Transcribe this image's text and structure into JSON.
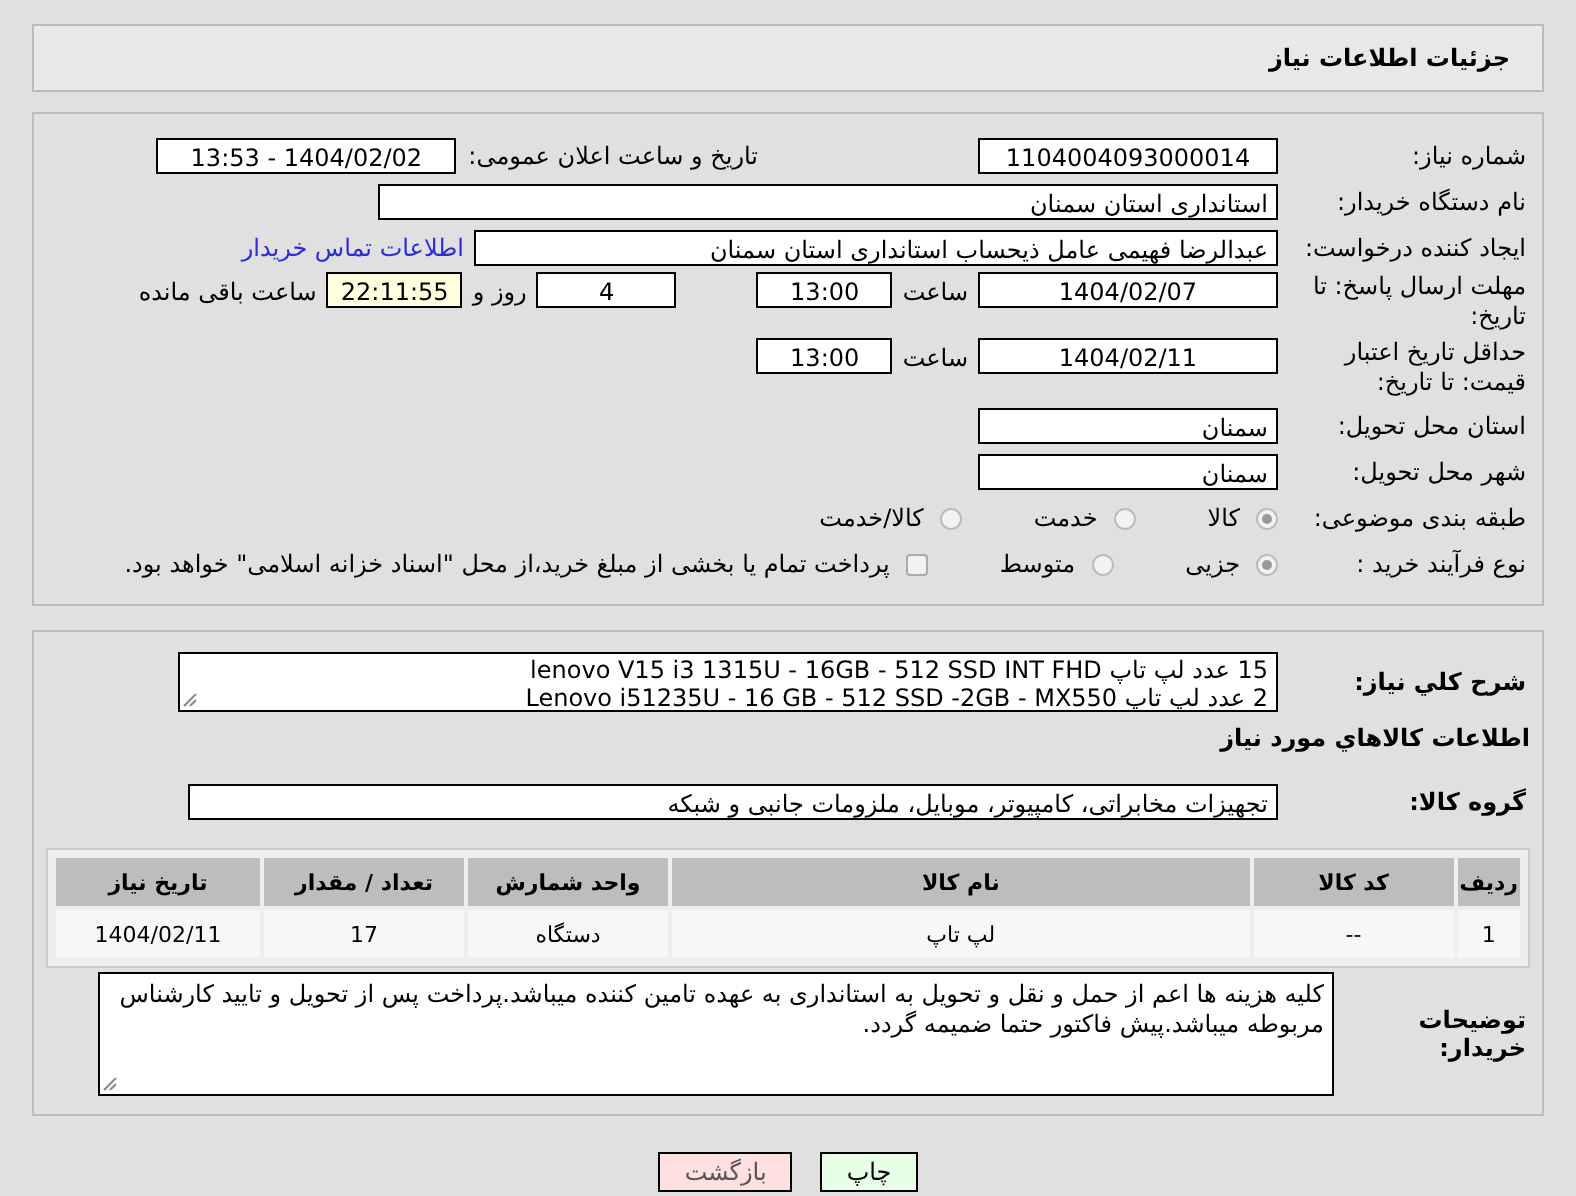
{
  "header": {
    "title": "جزئیات اطلاعات نیاز"
  },
  "need_number": {
    "label": "شماره نیاز:",
    "value": "1104004093000014"
  },
  "announce": {
    "label": "تاریخ و ساعت اعلان عمومی:",
    "value": "1404/02/02 - 13:53"
  },
  "buyer": {
    "label": "نام دستگاه خریدار:",
    "value": "استانداری استان سمنان"
  },
  "requester": {
    "label": "ایجاد کننده درخواست:",
    "value": "عبدالرضا فهیمی عامل ذیحساب استانداری استان سمنان",
    "link": "اطلاعات تماس خریدار"
  },
  "deadline": {
    "label": "مهلت ارسال پاسخ: تا تاریخ:",
    "date": "1404/02/07",
    "time_label": "ساعت",
    "time": "13:00",
    "days": "4",
    "days_label": "روز و",
    "remaining": "22:11:55",
    "remaining_label": "ساعت باقی مانده"
  },
  "validity": {
    "label": "حداقل تاریخ اعتبار قیمت: تا تاریخ:",
    "date": "1404/02/11",
    "time_label": "ساعت",
    "time": "13:00"
  },
  "province": {
    "label": "استان محل تحویل:",
    "value": "سمنان"
  },
  "city": {
    "label": "شهر محل تحویل:",
    "value": "سمنان"
  },
  "category": {
    "label": "طبقه بندی موضوعی:",
    "options": [
      {
        "label": "کالا",
        "selected": true
      },
      {
        "label": "خدمت",
        "selected": false
      },
      {
        "label": "کالا/خدمت",
        "selected": false
      }
    ]
  },
  "process": {
    "label": "نوع فرآیند خرید :",
    "options": [
      {
        "label": "جزیی",
        "selected": true
      },
      {
        "label": "متوسط",
        "selected": false
      }
    ],
    "treasury": {
      "label": "پرداخت تمام یا بخشی از مبلغ خرید،از محل \"اسناد خزانه اسلامی\" خواهد بود.",
      "checked": false
    }
  },
  "description": {
    "label": "شرح کلي نياز:",
    "lines": [
      "15 عدد لپ تاپ lenovo V15 i3 1315U - 16GB - 512 SSD INT FHD",
      "2 عدد لپ تاپ Lenovo i51235U - 16 GB - 512 SSD -2GB - MX550"
    ]
  },
  "goods_heading": "اطلاعات کالاهاي مورد نياز",
  "goods_group": {
    "label": "گروه کالا:",
    "value": "تجهیزات مخابراتی، کامپیوتر، موبایل، ملزومات جانبی و شبکه"
  },
  "table": {
    "columns": [
      "ردیف",
      "کد کالا",
      "نام کالا",
      "واحد شمارش",
      "تعداد / مقدار",
      "تاریخ نیاز"
    ],
    "rows": [
      [
        "1",
        "--",
        "لپ تاپ",
        "دستگاه",
        "17",
        "1404/02/11"
      ]
    ]
  },
  "buyer_notes": {
    "label": "توضیحات خریدار:",
    "value": "کلیه هزینه ها اعم از حمل و نقل و تحویل به استانداری به عهده تامین کننده میباشد.پرداخت پس از تحویل و تایید کارشناس مربوطه میباشد.پیش فاکتور حتما ضمیمه گردد."
  },
  "buttons": [
    {
      "label": "چاپ",
      "kind": "print"
    },
    {
      "label": "بازگشت",
      "kind": "back"
    }
  ]
}
